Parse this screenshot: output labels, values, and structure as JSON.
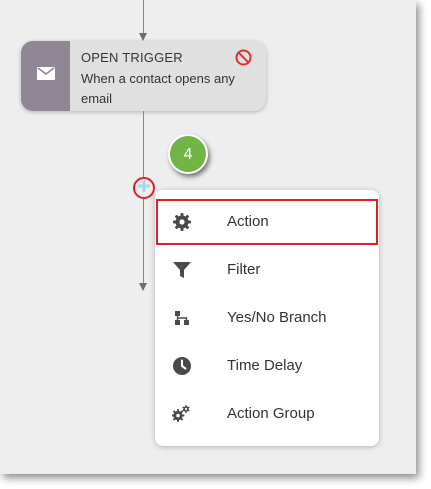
{
  "trigger": {
    "title": "OPEN TRIGGER",
    "description": "When a contact opens any email",
    "icon": "envelope-icon",
    "status_icon": "prohibited-icon"
  },
  "step_badge": "4",
  "add_step_icon": "plus-icon",
  "menu": {
    "items": [
      {
        "label": "Action",
        "icon": "gear-icon",
        "highlighted": true
      },
      {
        "label": "Filter",
        "icon": "filter-icon"
      },
      {
        "label": "Yes/No Branch",
        "icon": "branch-icon"
      },
      {
        "label": "Time Delay",
        "icon": "clock-icon"
      },
      {
        "label": "Action Group",
        "icon": "gears-icon"
      }
    ]
  },
  "colors": {
    "canvas": "#eeeeee",
    "trigger_panel": "#8f8696",
    "badge": "#71b546",
    "highlight": "#e01e26",
    "connector": "#7a8c91",
    "icon": "#4a4a4a"
  }
}
